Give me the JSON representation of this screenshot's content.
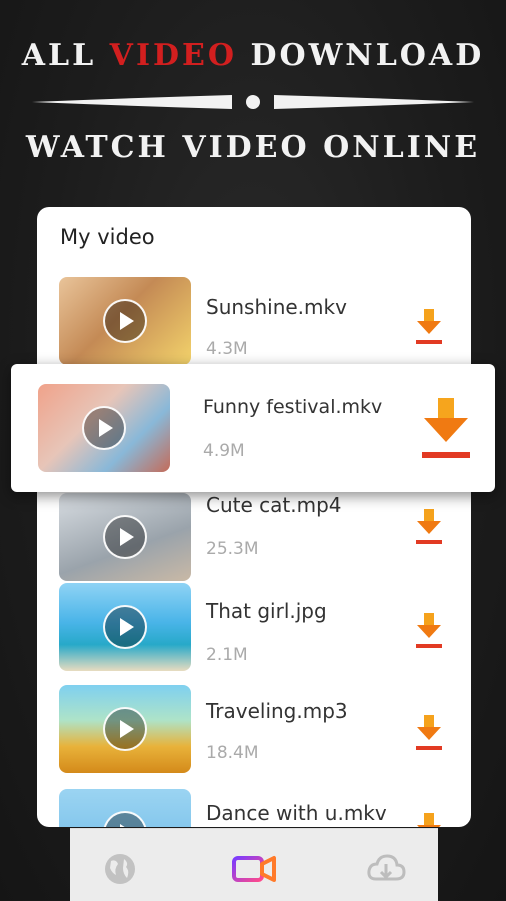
{
  "header": {
    "line1_part1": "ALL ",
    "line1_accent": "VIDEO",
    "line1_part2": " DOWNLOAD",
    "line2": "WATCH VIDEO ONLINE"
  },
  "card": {
    "title": "My video",
    "videos": [
      {
        "name": "Sunshine.mkv",
        "size": "4.3M"
      },
      {
        "name": "Cute cat.mp4",
        "size": "25.3M"
      },
      {
        "name": "That girl.jpg",
        "size": "2.1M"
      },
      {
        "name": "Traveling.mp3",
        "size": "18.4M"
      },
      {
        "name": "Dance with u.mkv",
        "size": ""
      }
    ],
    "featured": {
      "name": "Funny festival.mkv",
      "size": "4.9M"
    }
  },
  "bottom_nav": [
    {
      "icon": "globe-icon"
    },
    {
      "icon": "video-camera-icon"
    },
    {
      "icon": "cloud-download-icon"
    }
  ],
  "colors": {
    "accent_red": "#d21f1f",
    "download_orange": "#f07a12",
    "camera_purple": "#7a3cff"
  }
}
